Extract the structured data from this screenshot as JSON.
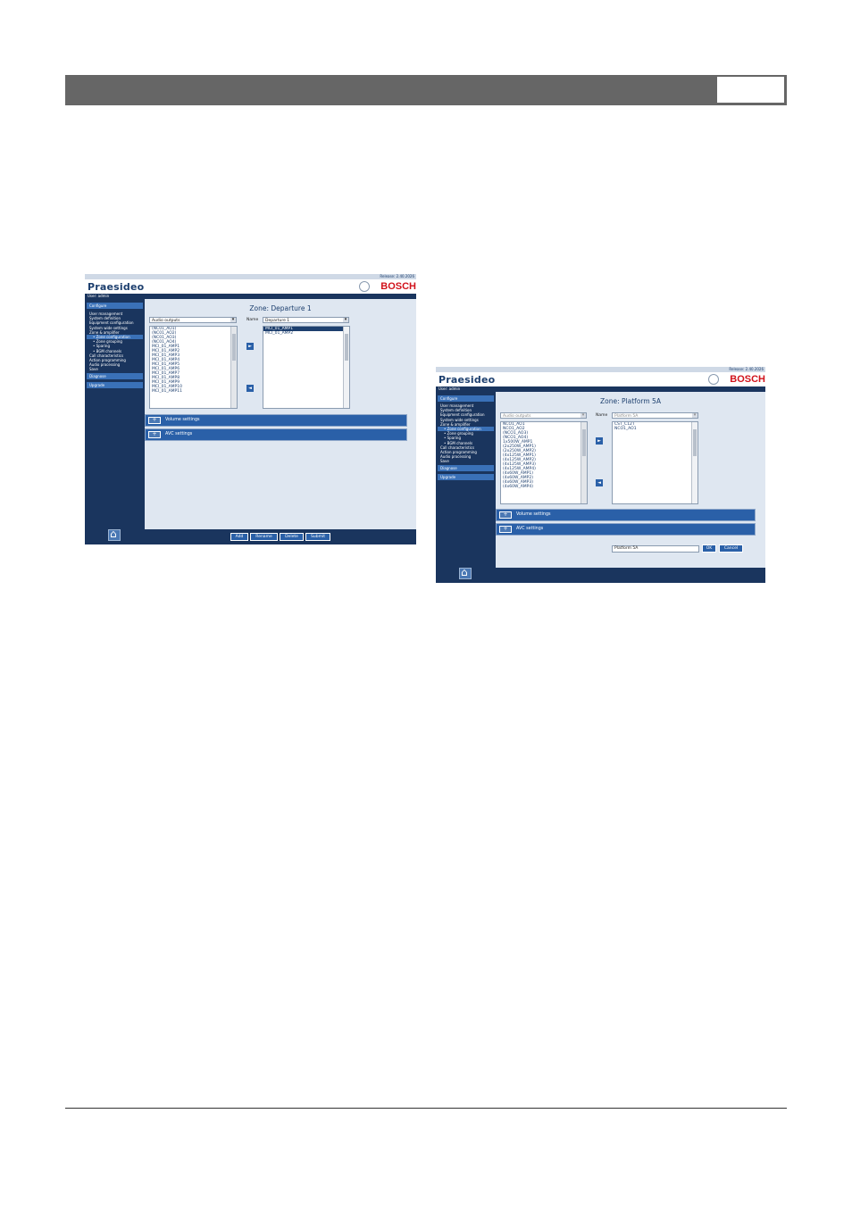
{
  "screenshot1": {
    "release": "Release: 2.40.2026",
    "brand": "Praesideo",
    "bosch": "BOSCH",
    "user": "User: admin",
    "nav": {
      "configure": "Configure",
      "items": [
        "User management",
        "System definition",
        "Equipment configuration",
        "System wide settings",
        "Zone & amplifier"
      ],
      "subitems": [
        "Zone configuration",
        "Zone grouping",
        "Sparing",
        "BGM channels"
      ],
      "items2": [
        "Call characteristics",
        "Action programming",
        "Audio processing",
        "Save"
      ],
      "diagnose": "Diagnose",
      "upgrade": "Upgrade"
    },
    "zone_title": "Zone: Departure 1",
    "left_select": "Audio outputs",
    "name_label": "Name",
    "name_select": "Departure 1",
    "left_list": [
      "(NC01_AO1)",
      "(NC01_AO2)",
      "(NC01_AO3)",
      "(NC01_AO4)",
      "MCI_01_AMP1",
      "MCI_01_AMP2",
      "MCI_01_AMP3",
      "MCI_01_AMP4",
      "MCI_01_AMP5",
      "MCI_01_AMP6",
      "MCI_01_AMP7",
      "MCI_01_AMP8",
      "MCI_01_AMP9",
      "MCI_01_AMP10",
      "MCI_01_AMP11"
    ],
    "right_list": [
      "MCI_01_AMP1",
      "MCI_01_AMP2"
    ],
    "arrow_right": "►",
    "arrow_left": "◄",
    "volume_settings": "Volume settings",
    "avc_settings": "AVC settings",
    "plus": "+",
    "buttons": [
      "Add",
      "Rename",
      "Delete",
      "Submit"
    ]
  },
  "screenshot2": {
    "release": "Release: 2.40.2026",
    "brand": "Praesideo",
    "bosch": "BOSCH",
    "user": "User: admin",
    "nav": {
      "configure": "Configure",
      "items": [
        "User management",
        "System definition",
        "Equipment configuration",
        "System wide settings",
        "Zone & amplifier"
      ],
      "subitems": [
        "Zone configuration",
        "Zone grouping",
        "Sparing",
        "BGM channels"
      ],
      "items2": [
        "Call characteristics",
        "Action programming",
        "Audio processing",
        "Save"
      ],
      "diagnose": "Diagnose",
      "upgrade": "Upgrade"
    },
    "zone_title": "Zone: Platform 5A",
    "left_select": "Audio outputs",
    "name_label": "Name",
    "name_select": "Platform 5A",
    "left_list": [
      "NCO1_AO1",
      "NCO1_AO2",
      "(NCO1_AO3)",
      "(NCO1_AO4)",
      "1x500W_AMP1",
      "(2x250W_AMP1)",
      "(2x250W_AMP2)",
      "(4x125W_AMP1)",
      "(4x125W_AMP2)",
      "(4x125W_AMP3)",
      "(4x125W_AMP4)",
      "(4x60W_AMP1)",
      "(4x60W_AMP2)",
      "(4x60W_AMP3)",
      "(4x60W_AMP4)"
    ],
    "right_list": [
      "CST_C12T",
      "NCO1_AO1"
    ],
    "arrow_right": "►",
    "arrow_left": "◄",
    "volume_settings": "Volume settings",
    "avc_settings": "AVC settings",
    "plus": "+",
    "rename_value": "Platform 5A",
    "ok": "OK",
    "cancel": "Cancel"
  }
}
